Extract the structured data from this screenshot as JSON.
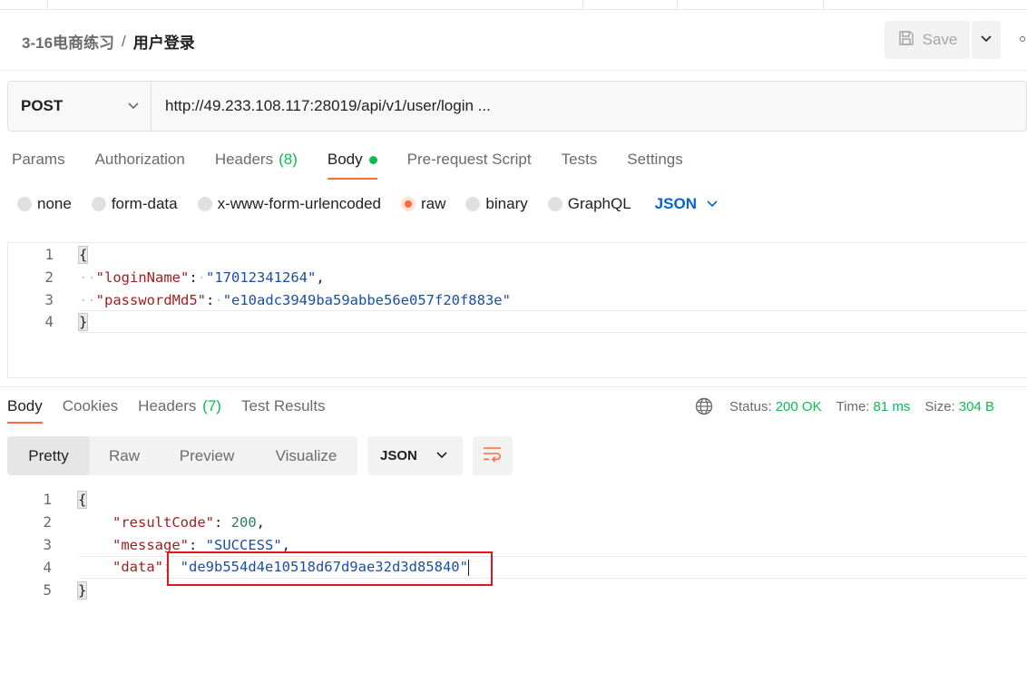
{
  "breadcrumb": {
    "collection": "3-16电商练习",
    "separator": "/",
    "request": "用户登录"
  },
  "toolbar": {
    "save_label": "Save"
  },
  "request": {
    "method": "POST",
    "url": "http://49.233.108.117:28019/api/v1/user/login ..."
  },
  "request_tabs": [
    {
      "label": "Params"
    },
    {
      "label": "Authorization"
    },
    {
      "label": "Headers",
      "count": "(8)"
    },
    {
      "label": "Body"
    },
    {
      "label": "Pre-request Script"
    },
    {
      "label": "Tests"
    },
    {
      "label": "Settings"
    }
  ],
  "body_types": {
    "options": [
      "none",
      "form-data",
      "x-www-form-urlencoded",
      "raw",
      "binary",
      "GraphQL"
    ],
    "selected": "raw",
    "format": "JSON"
  },
  "request_body": {
    "line_numbers": [
      "1",
      "2",
      "3",
      "4"
    ],
    "open_brace": "{",
    "close_brace": "}",
    "key1": "\"loginName\"",
    "val1": "\"17012341264\"",
    "key2": "\"passwordMd5\"",
    "val2": "\"e10adc3949ba59abbe56e057f20f883e\""
  },
  "response_tabs": [
    {
      "label": "Body"
    },
    {
      "label": "Cookies"
    },
    {
      "label": "Headers",
      "count": "(7)"
    },
    {
      "label": "Test Results"
    }
  ],
  "response_status": {
    "status_label": "Status:",
    "status_value": "200 OK",
    "time_label": "Time:",
    "time_value": "81 ms",
    "size_label": "Size:",
    "size_value": "304 B"
  },
  "view_tabs": [
    "Pretty",
    "Raw",
    "Preview",
    "Visualize"
  ],
  "response_format": "JSON",
  "response_body": {
    "line_numbers": [
      "1",
      "2",
      "3",
      "4",
      "5"
    ],
    "open_brace": "{",
    "close_brace": "}",
    "key1": "\"resultCode\"",
    "val1": "200",
    "key2": "\"message\"",
    "val2": "\"SUCCESS\"",
    "key3": "\"data\"",
    "val3": "\"de9b554d4e10518d67d9ae32d3d85840\""
  },
  "colors": {
    "accent": "#ff6c37",
    "success": "#0cbb52",
    "link": "#0265d2",
    "highlight_box": "#e0161d"
  },
  "icons": [
    "save-icon",
    "chevron-down-icon",
    "globe-icon",
    "wrap-lines-icon"
  ]
}
